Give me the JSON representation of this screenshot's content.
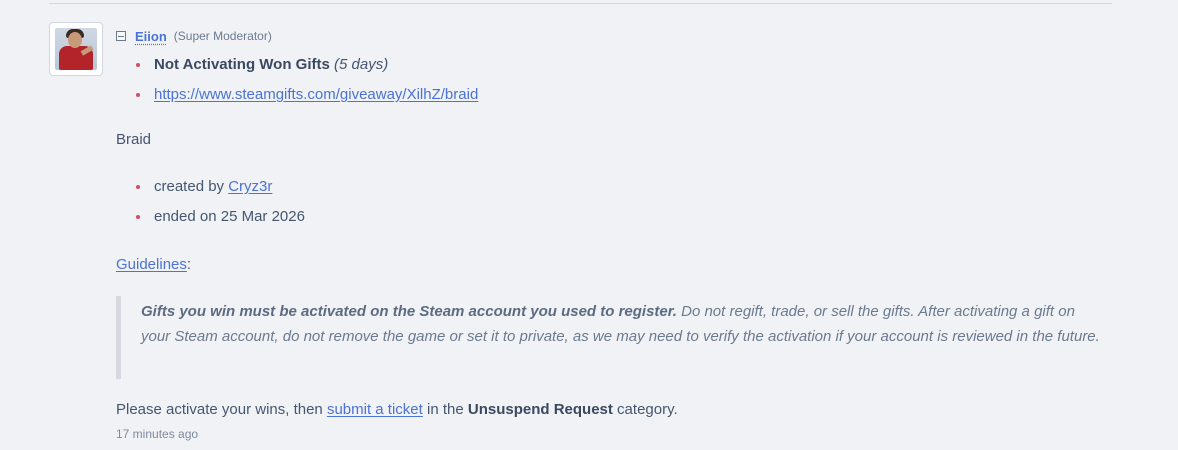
{
  "comment": {
    "author": {
      "name": "Eiion",
      "role": "(Super Moderator)"
    },
    "reason": {
      "title": "Not Activating Won Gifts",
      "duration": "(5 days)"
    },
    "giveaway_url": "https://www.steamgifts.com/giveaway/XilhZ/braid",
    "game_title": "Braid",
    "details": {
      "created_by_label": "created by",
      "creator": "Cryz3r",
      "ended_on": "ended on 25 Mar 2026"
    },
    "guidelines": {
      "link": "Guidelines",
      "colon": ":"
    },
    "quote": {
      "bold": "Gifts you win must be activated on the Steam account you used to register.",
      "text": " Do not regift, trade, or sell the gifts. After activating a gift on your Steam account, do not remove the game or set it to private, as we may need to verify the activation if your account is reviewed in the future."
    },
    "instruction": {
      "before": "Please activate your wins, then ",
      "link": "submit a ticket",
      "middle": " in the ",
      "category": "Unsuspend Request",
      "after": " category."
    },
    "timestamp": "17 minutes ago"
  },
  "colors": {
    "link": "#4b72d4",
    "bullet": "#d34e63",
    "text": "#465670",
    "background": "#f0f2f5"
  }
}
